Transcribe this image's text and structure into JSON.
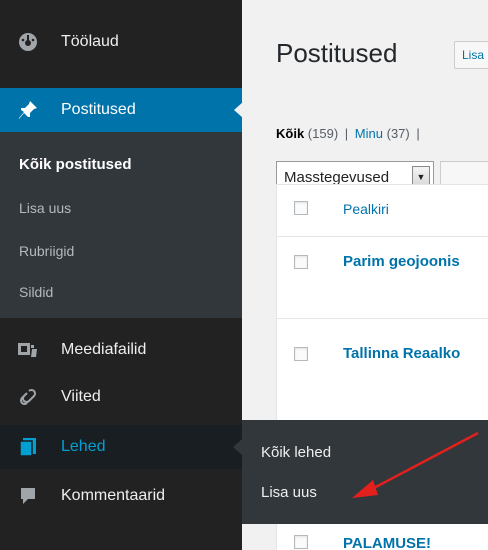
{
  "sidebar": {
    "dashboard": {
      "label": "Töölaud",
      "icon": "dashboard-icon"
    },
    "posts": {
      "label": "Postitused",
      "icon": "pin-icon"
    },
    "posts_submenu": {
      "all": "Kõik postitused",
      "add_new": "Lisa uus",
      "categories": "Rubriigid",
      "tags": "Sildid"
    },
    "media": {
      "label": "Meediafailid",
      "icon": "media-icon"
    },
    "links": {
      "label": "Viited",
      "icon": "link-icon"
    },
    "pages": {
      "label": "Lehed",
      "icon": "pages-icon"
    },
    "comments": {
      "label": "Kommentaarid",
      "icon": "comment-icon"
    }
  },
  "pages_flyout": {
    "all_pages": "Kõik lehed",
    "add_new": "Lisa uus"
  },
  "main": {
    "title": "Postitused",
    "add_new_button": "Lisa uus",
    "filters": {
      "all_label": "Kõik",
      "all_count": "(159)",
      "separator": "|",
      "mine_label": "Minu",
      "mine_count": "(37)",
      "trailing_separator": "|"
    },
    "bulk_actions": {
      "selected": "Masstegevused"
    },
    "table": {
      "header_title": "Pealkiri",
      "rows": [
        {
          "title": "Parim geojoonis"
        },
        {
          "title": "Tallinna Reaalko"
        },
        {
          "title": "PALAMUSE!"
        }
      ]
    }
  },
  "colors": {
    "sidebar_bg": "#222222",
    "submenu_bg": "#32373c",
    "active_bg": "#0073aa",
    "link": "#0073aa",
    "annotation_arrow": "#e3201b"
  }
}
